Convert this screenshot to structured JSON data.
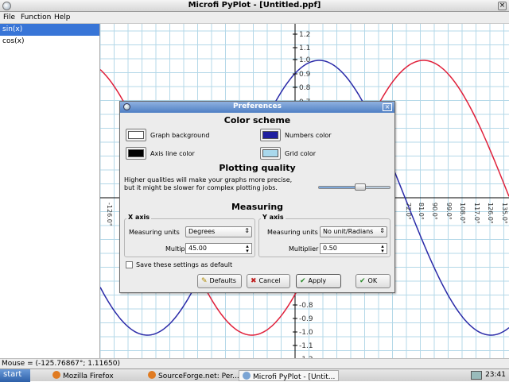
{
  "window": {
    "title": "Microfi PyPlot - [Untitled.ppf]"
  },
  "menu": {
    "file": "File",
    "function": "Function",
    "help": "Help"
  },
  "functions": [
    {
      "label": "sin(x)",
      "selected": true,
      "color": "#e0203a"
    },
    {
      "label": "cos(x)",
      "selected": false,
      "color": "#2a2aa8"
    }
  ],
  "plot": {
    "y_ticks": [
      "1.2",
      "1.1",
      "1.0",
      "0.9",
      "0.8",
      "0.7",
      "-0.8",
      "-0.9",
      "-1.0",
      "-1.1",
      "-1.2"
    ],
    "x_ticks": [
      "-126.0°",
      "72.0°",
      "81.0°",
      "90.0°",
      "99.0°",
      "108.0°",
      "117.0°",
      "126.0°",
      "135.0°"
    ],
    "grid_color": "#b4d8e8",
    "axis_color": "#000000"
  },
  "status": {
    "mouse": "Mouse = (-125.76867°; 1.11650)"
  },
  "taskbar": {
    "start": "start",
    "tasks": [
      "Mozilla Firefox",
      "SourceForge.net: Per...",
      "Microfi PyPlot - [Untit..."
    ],
    "clock": "23:41"
  },
  "dialog": {
    "title": "Preferences",
    "color_scheme": {
      "heading": "Color scheme",
      "graph_background": {
        "label": "Graph background",
        "color": "#ffffff"
      },
      "numbers_color": {
        "label": "Numbers color",
        "color": "#2020a0"
      },
      "axis_line_color": {
        "label": "Axis line color",
        "color": "#000000"
      },
      "grid_color": {
        "label": "Grid color",
        "color": "#a8d8ec"
      }
    },
    "plotting_quality": {
      "heading": "Plotting quality",
      "description": "Higher qualities will make your graphs more precise, but it might be slower for complex plotting jobs.",
      "level": 0.6
    },
    "measuring": {
      "heading": "Measuring",
      "x_axis": {
        "title": "X axis",
        "units_label": "Measuring units",
        "units_value": "Degrees",
        "multiplier_label": "Multiplier",
        "multiplier_value": "45.00"
      },
      "y_axis": {
        "title": "Y axis",
        "units_label": "Measuring units",
        "units_value": "No unit/Radians",
        "multiplier_label": "Multiplier",
        "multiplier_value": "0.50"
      }
    },
    "save_settings": {
      "label": "Save these settings as default",
      "checked": false
    },
    "buttons": {
      "defaults": "Defaults",
      "cancel": "Cancel",
      "apply": "Apply",
      "ok": "OK"
    }
  }
}
